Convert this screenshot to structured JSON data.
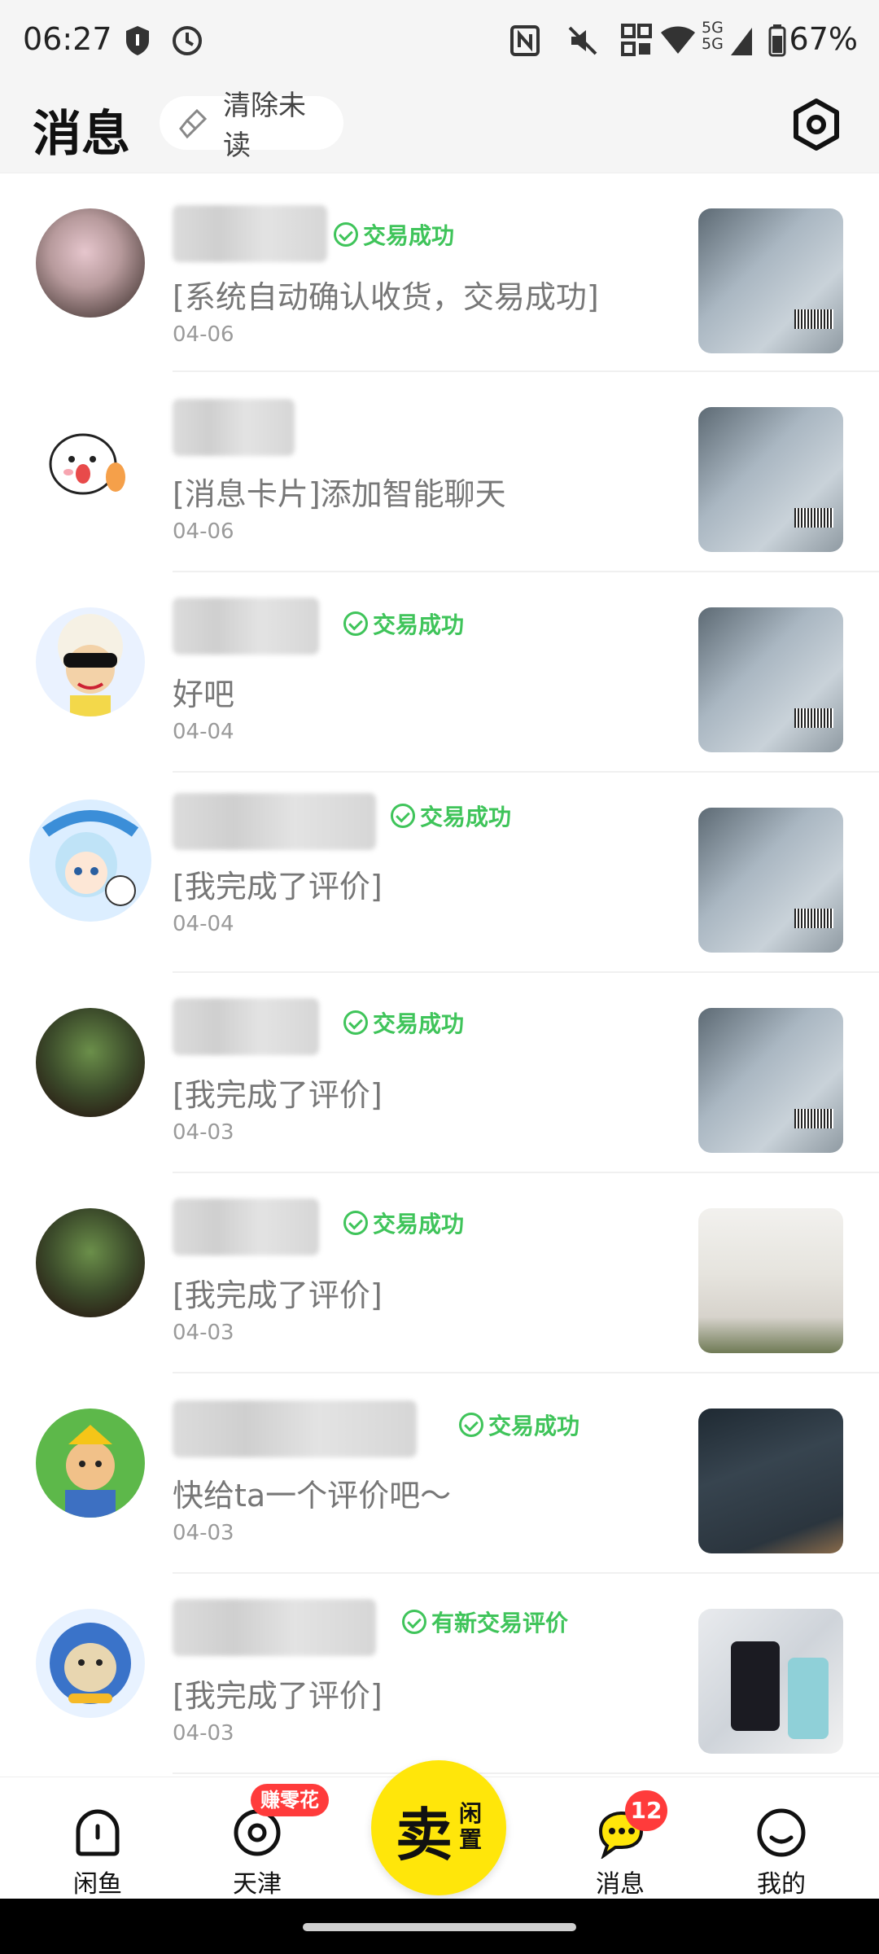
{
  "status_bar": {
    "time": "06:27",
    "battery": "67%",
    "signal_label": "5G",
    "icons": [
      "shield-icon",
      "clock-icon",
      "nfc-icon",
      "mute-icon",
      "data-icon",
      "wifi-icon",
      "signal-icon",
      "battery-icon"
    ]
  },
  "header": {
    "title": "消息",
    "clear_unread": "清除未读",
    "settings_icon": "settings-icon"
  },
  "messages": [
    {
      "badge": "交易成功",
      "text": "[系统自动确认收货，交易成功]",
      "date": "04-06"
    },
    {
      "badge": "",
      "text": "[消息卡片]添加智能聊天",
      "date": "04-06"
    },
    {
      "badge": "交易成功",
      "text": "好吧",
      "date": "04-04"
    },
    {
      "badge": "交易成功",
      "text": "[我完成了评价]",
      "date": "04-04"
    },
    {
      "badge": "交易成功",
      "text": "[我完成了评价]",
      "date": "04-03"
    },
    {
      "badge": "交易成功",
      "text": "[我完成了评价]",
      "date": "04-03"
    },
    {
      "badge": "交易成功",
      "text": "快给ta一个评价吧～",
      "date": "04-03"
    },
    {
      "badge": "有新交易评价",
      "text": "[我完成了评价]",
      "date": "04-03"
    }
  ],
  "nav": {
    "items": [
      {
        "label": "闲鱼",
        "icon": "home-icon"
      },
      {
        "label": "天津",
        "icon": "location-icon",
        "badge": "赚零花"
      },
      {
        "label": "消息",
        "icon": "message-icon",
        "badge": "12"
      },
      {
        "label": "我的",
        "icon": "profile-icon"
      }
    ],
    "sell_big": "卖",
    "sell_small": "闲置"
  },
  "colors": {
    "accent_yellow": "#ffe60a",
    "success_green": "#3fc45a",
    "badge_red": "#ff3b3b"
  }
}
